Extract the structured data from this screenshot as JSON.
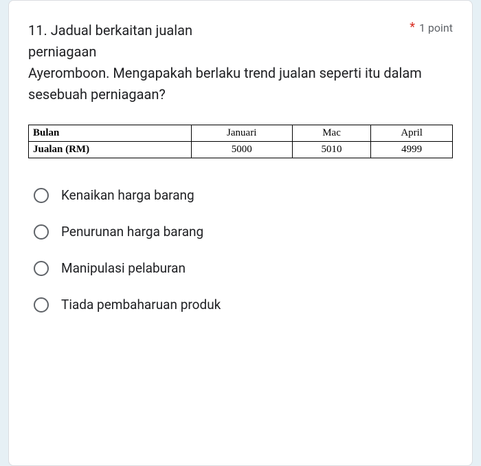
{
  "question": {
    "number_and_first_line": "11. Jadual berkaitan jualan",
    "rest": "perniagaan\nAyeromboon. Mengapakah berlaku trend jualan seperti itu dalam sesebuah perniagaan?",
    "required_mark": "*",
    "points_label": "1 point"
  },
  "chart_data": {
    "type": "table",
    "row_label_header": "Bulan",
    "value_row_header": "Jualan (RM)",
    "categories": [
      "Januari",
      "Mac",
      "April"
    ],
    "values": [
      5000,
      5010,
      4999
    ]
  },
  "options": [
    "Kenaikan harga barang",
    "Penurunan harga barang",
    "Manipulasi pelaburan",
    "Tiada pembaharuan produk"
  ]
}
